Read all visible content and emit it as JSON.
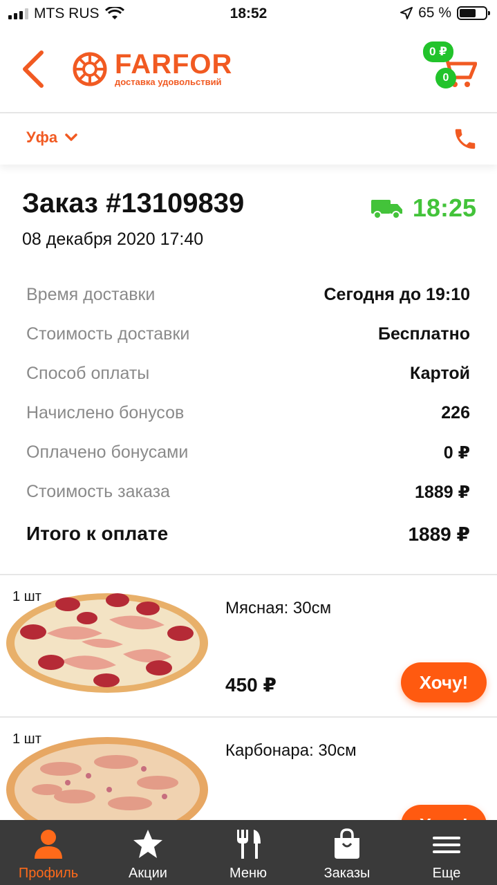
{
  "status_bar": {
    "carrier": "MTS RUS",
    "time": "18:52",
    "battery": "65 %",
    "battery_level": 0.65
  },
  "header": {
    "logo_name": "FARFOR",
    "logo_tagline": "доставка удовольствий",
    "cart_price": "0 ₽",
    "cart_count": "0",
    "back_icon": "chevron-left-icon",
    "cart_icon": "cart-icon"
  },
  "city_bar": {
    "city": "Уфа",
    "phone_icon": "phone-icon"
  },
  "order": {
    "title": "Заказ #13109839",
    "date": "08 декабря 2020 17:40",
    "eta": "18:25",
    "eta_icon": "truck-icon",
    "details": [
      {
        "label": "Время доставки",
        "value": "Сегодня до 19:10"
      },
      {
        "label": "Стоимость доставки",
        "value": "Бесплатно"
      },
      {
        "label": "Способ оплаты",
        "value": "Картой"
      },
      {
        "label": "Начислено бонусов",
        "value": "226"
      },
      {
        "label": "Оплачено бонусами",
        "value": "0 ₽"
      },
      {
        "label": "Стоимость заказа",
        "value": "1889 ₽"
      }
    ],
    "total_label": "Итого к оплате",
    "total_value": "1889 ₽"
  },
  "items": [
    {
      "qty": "1 шт",
      "name": "Мясная: 30см",
      "price": "450 ₽",
      "button": "Хочу!"
    },
    {
      "qty": "1 шт",
      "name": "Карбонара: 30см",
      "price": "",
      "button": "Хочу!"
    }
  ],
  "colors": {
    "brand": "#f15a22",
    "accent_green": "#43c33a",
    "tabbar": "#3a3a3a"
  },
  "tabbar": [
    {
      "label": "Профиль",
      "icon": "profile-icon",
      "active": true
    },
    {
      "label": "Акции",
      "icon": "star-icon",
      "active": false
    },
    {
      "label": "Меню",
      "icon": "fork-knife-icon",
      "active": false
    },
    {
      "label": "Заказы",
      "icon": "shopping-bag-icon",
      "active": false
    },
    {
      "label": "Еще",
      "icon": "menu-icon",
      "active": false
    }
  ]
}
